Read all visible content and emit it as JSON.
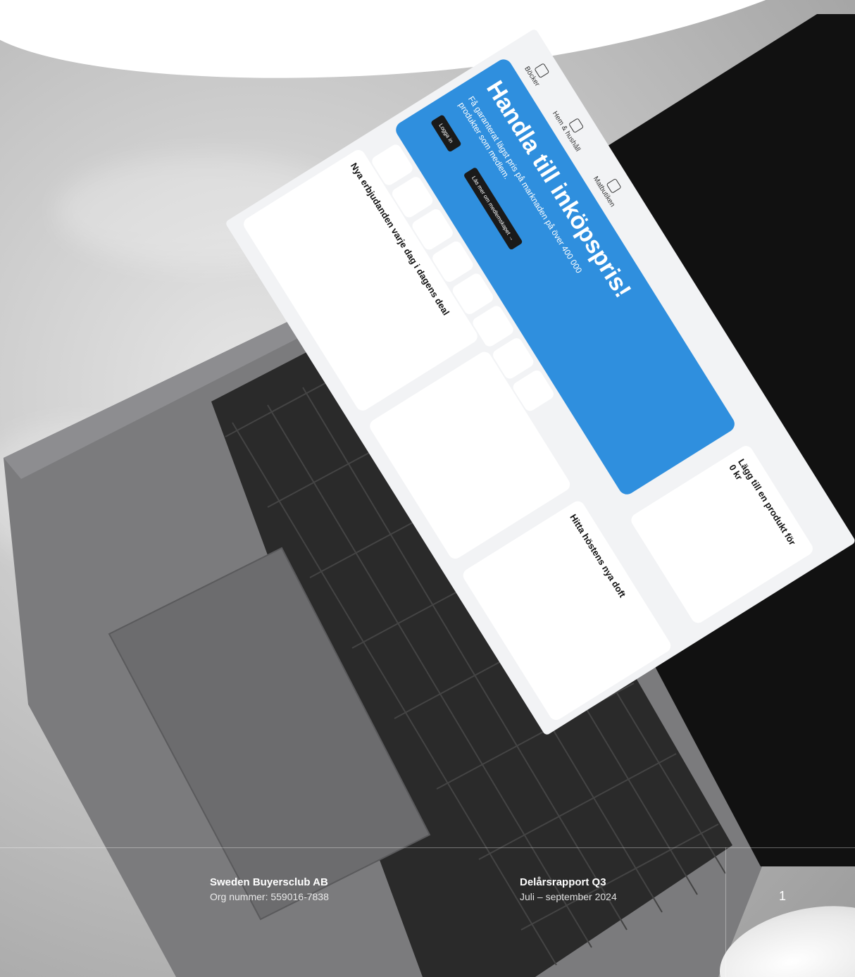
{
  "screen": {
    "nav": [
      {
        "label": "Böcker",
        "icon": "books-icon"
      },
      {
        "label": "Hem & hushåll",
        "icon": "lightbulb-icon"
      },
      {
        "label": "Matbutiken",
        "icon": "grocery-icon"
      }
    ],
    "hero": {
      "title": "Handla till inköpspris!",
      "subtitle": "Få garanterat lägst pris på marknaden på över 400 000 produkter som medlem.",
      "login_button": "Logga in",
      "more_button": "Läs mer om medlemskapet →"
    },
    "cards": {
      "daily_deal": "Nya erbjudanden varje dag i dagens deal",
      "free_product": "Lägg till en produkt för 0 kr",
      "watches": "",
      "fragrance": "Hitta höstens nya doft"
    }
  },
  "footer": {
    "company_name": "Sweden Buyersclub AB",
    "org_number": "Org nummer: 559016-7838",
    "report_title": "Delårsrapport Q3",
    "report_period": "Juli – september 2024",
    "page_number": "1"
  },
  "colors": {
    "hero_blue": "#2f8fde",
    "laptop_body": "#7a7a7c",
    "keyboard": "#1a1a1a"
  }
}
